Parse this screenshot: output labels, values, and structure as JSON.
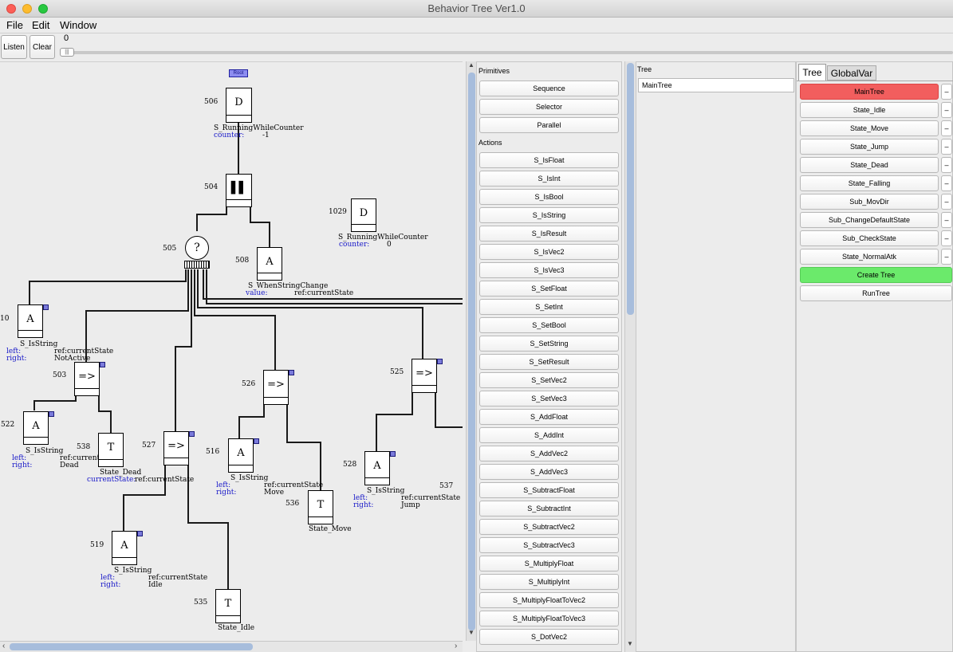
{
  "window": {
    "title": "Behavior Tree Ver1.0"
  },
  "menu": [
    "File",
    "Edit",
    "Window"
  ],
  "toolbar": {
    "listen": "Listen",
    "clear": "Clear",
    "slider_value": "0"
  },
  "canvas": {
    "root_label": "Root",
    "nodes": [
      {
        "id": "506",
        "sym": "D",
        "label": "S_RunningWhileCounter",
        "params": [
          {
            "k": "counter:",
            "v": "-1"
          }
        ]
      },
      {
        "id": "504",
        "sym": "▌▌",
        "label": "",
        "params": []
      },
      {
        "id": "505",
        "sym": "?",
        "label": "",
        "params": []
      },
      {
        "id": "508",
        "sym": "A",
        "label": "S_WhenStringChange",
        "params": [
          {
            "k": "value:",
            "v": "ref:currentState"
          }
        ]
      },
      {
        "id": "1029",
        "sym": "D",
        "label": "S_RunningWhileCounter",
        "params": [
          {
            "k": "counter:",
            "v": "0"
          }
        ]
      },
      {
        "id": "10",
        "sym": "A",
        "label": "S_IsString",
        "params": [
          {
            "k": "left:",
            "v": "ref:currentState"
          },
          {
            "k": "right:",
            "v": "NotActive"
          }
        ]
      },
      {
        "id": "503",
        "sym": "=>",
        "label": "",
        "params": []
      },
      {
        "id": "522",
        "sym": "A",
        "label": "S_IsString",
        "params": [
          {
            "k": "left:",
            "v": "ref:currentS"
          },
          {
            "k": "right:",
            "v": "Dead"
          }
        ]
      },
      {
        "id": "538",
        "sym": "T",
        "label": "State_Dead",
        "params": [
          {
            "k": "currentState:",
            "v": "ref:currentState"
          }
        ]
      },
      {
        "id": "527",
        "sym": "=>",
        "label": "",
        "params": []
      },
      {
        "id": "526",
        "sym": "=>",
        "label": "",
        "params": []
      },
      {
        "id": "516",
        "sym": "A",
        "label": "S_IsString",
        "params": [
          {
            "k": "left:",
            "v": "ref:currentState"
          },
          {
            "k": "right:",
            "v": "Move"
          }
        ]
      },
      {
        "id": "536",
        "sym": "T",
        "label": "State_Move",
        "params": []
      },
      {
        "id": "525",
        "sym": "=>",
        "label": "",
        "params": []
      },
      {
        "id": "528",
        "sym": "A",
        "label": "S_IsString",
        "params": [
          {
            "k": "left:",
            "v": "ref:currentState"
          },
          {
            "k": "right:",
            "v": "Jump"
          }
        ]
      },
      {
        "id": "537",
        "sym": "",
        "label": "",
        "params": []
      },
      {
        "id": "519",
        "sym": "A",
        "label": "S_IsString",
        "params": [
          {
            "k": "left:",
            "v": "ref:currentState"
          },
          {
            "k": "right:",
            "v": "Idle"
          }
        ]
      },
      {
        "id": "535",
        "sym": "T",
        "label": "State_Idle",
        "params": []
      }
    ]
  },
  "primitives": {
    "title": "Primitives",
    "items": [
      "Sequence",
      "Selector",
      "Parallel"
    ],
    "actions_title": "Actions",
    "actions": [
      "S_IsFloat",
      "S_IsInt",
      "S_IsBool",
      "S_IsString",
      "S_IsResult",
      "S_IsVec2",
      "S_IsVec3",
      "S_SetFloat",
      "S_SetInt",
      "S_SetBool",
      "S_SetString",
      "S_SetResult",
      "S_SetVec2",
      "S_SetVec3",
      "S_AddFloat",
      "S_AddInt",
      "S_AddVec2",
      "S_AddVec3",
      "S_SubtractFloat",
      "S_SubtractInt",
      "S_SubtractVec2",
      "S_SubtractVec3",
      "S_MultiplyFloat",
      "S_MultiplyInt",
      "S_MultiplyFloatToVec2",
      "S_MultiplyFloatToVec3",
      "S_DotVec2"
    ]
  },
  "tree_panel": {
    "title": "Tree",
    "value": "MainTree"
  },
  "tabs": [
    "Tree",
    "GlobalVar"
  ],
  "tree_list": {
    "items": [
      "MainTree",
      "State_Idle",
      "State_Move",
      "State_Jump",
      "State_Dead",
      "State_Falling",
      "Sub_MovDir",
      "Sub_ChangeDefaultState",
      "Sub_CheckState",
      "State_NormalAtk"
    ],
    "minus": "–",
    "create": "Create Tree",
    "run": "RunTree"
  },
  "colors": {
    "selected": "#f25e5e",
    "create": "#6bea6b",
    "handle": "#7b7bdb",
    "param_key": "#1616c8"
  }
}
